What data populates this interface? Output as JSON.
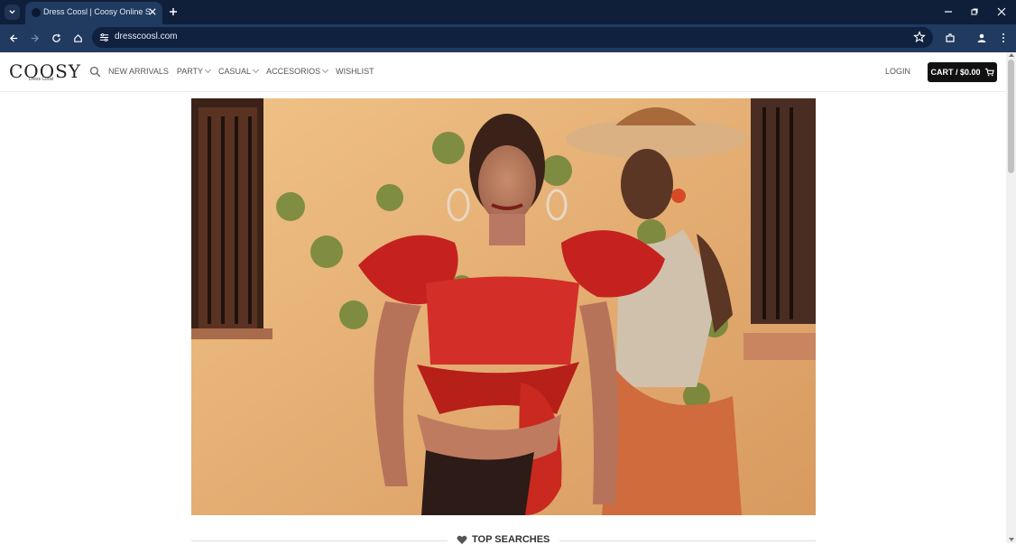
{
  "browser": {
    "tab_title": "Dress Coosl | Coosy Online Sale",
    "url": "dresscoosl.com"
  },
  "site": {
    "logo": "COOSY",
    "logo_sub": "Dress Coosl",
    "nav": [
      "NEW ARRIVALS",
      "PARTY",
      "CASUAL",
      "ACCESORIOS",
      "WISHLIST"
    ],
    "login": "LOGIN",
    "cart": "CART / $0.00",
    "section_heading": "TOP SEARCHES"
  },
  "colors": {
    "browser_dark": "#0f1f3a",
    "browser_bar": "#203a60",
    "cart_bg": "#111111"
  },
  "icons": [
    "search-icon",
    "cart-icon",
    "heart-icon",
    "back-icon",
    "forward-icon",
    "reload-icon",
    "home-icon",
    "star-icon",
    "extensions-icon",
    "profile-icon",
    "menu-icon"
  ]
}
